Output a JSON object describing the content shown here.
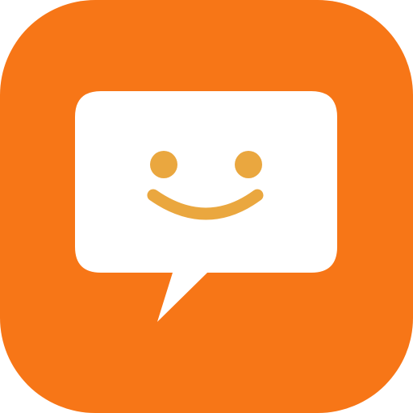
{
  "icon": {
    "name": "chat-smiley-app-icon",
    "glyph": "speech-bubble-smiley-icon",
    "colors": {
      "tile": "#F77617",
      "bubble": "#FFFFFF",
      "face": "#EAA73F"
    }
  }
}
